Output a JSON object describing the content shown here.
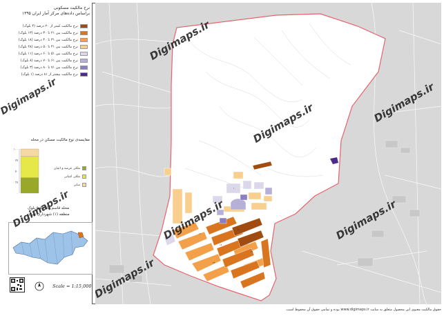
{
  "legend": {
    "title": "نرخ مالکیت مسکونی\nبراساس داده‌های مرکز آمار ایران ۱۳۹۵",
    "items": [
      {
        "label": "نرخ مالکیت کمتر از ۲۰ درصد (۴ بلوک)",
        "color": "#a04c10"
      },
      {
        "label": "نرخ مالکیت بین ۲۱ تا ۳۰ درصد (۱۳ بلوک)",
        "color": "#d9741f"
      },
      {
        "label": "نرخ مالکیت بین ۳۱ تا ۴۰ درصد (۱۸ بلوک)",
        "color": "#f2a14a"
      },
      {
        "label": "نرخ مالکیت بین ۴۱ تا ۵۰ درصد (۲۸ بلوک)",
        "color": "#f8cf8e"
      },
      {
        "label": "نرخ مالکیت بین ۵۱ تا ۶۰ درصد (۱۱ بلوک)",
        "color": "#dcd8ea"
      },
      {
        "label": "نرخ مالکیت بین ۶۱ تا ۷۰ درصد (۸ بلوک)",
        "color": "#b7b0d6"
      },
      {
        "label": "نرخ مالکیت بین ۷۱ تا ۸۰ درصد (۳ بلوک)",
        "color": "#8b7fc0"
      },
      {
        "label": "نرخ مالکیت بیشتر از ۸۱ درصد (۱ بلوک)",
        "color": "#4b2a8a"
      }
    ]
  },
  "chart": {
    "title": "مقایسه‌ی نوع مالکیت مسکن در محله",
    "ticks": [
      "۱۰۰",
      "۷۵",
      "۵۰",
      "۲۵",
      "۰"
    ],
    "legend": [
      {
        "label": "ملکی عرصه و اعیان",
        "color": "#9aa82a"
      },
      {
        "label": "ملکی اعیانی",
        "color": "#e6e84a"
      },
      {
        "label": "سایر",
        "color": "#f6d9a2"
      }
    ]
  },
  "chart_data": {
    "type": "bar",
    "categories": [
      ""
    ],
    "series": [
      {
        "name": "ملکی عرصه و اعیان",
        "values": [
          35
        ]
      },
      {
        "name": "ملکی اعیانی",
        "values": [
          48
        ]
      },
      {
        "name": "سایر",
        "values": [
          17
        ]
      }
    ],
    "ylim": [
      0,
      100
    ]
  },
  "location": {
    "line1": "محله قاسم آباد-۵۵-۵ بلوک",
    "line2": "منطقه (۱) شهرداری تهران"
  },
  "scale_text": "Scale = 1:15,000",
  "north_label": "N",
  "watermark_text": "Digimaps.ir",
  "footer_text": "حقوق مالکیت معنوی این محصول متعلق به سایت www.digimaps.ir بوده و تمامی حقوق آن محفوظ است.",
  "colors": {
    "boundary": "#e8616b",
    "background_map": "#d8d8d8",
    "neighborhood_fill": "#ffffff"
  }
}
